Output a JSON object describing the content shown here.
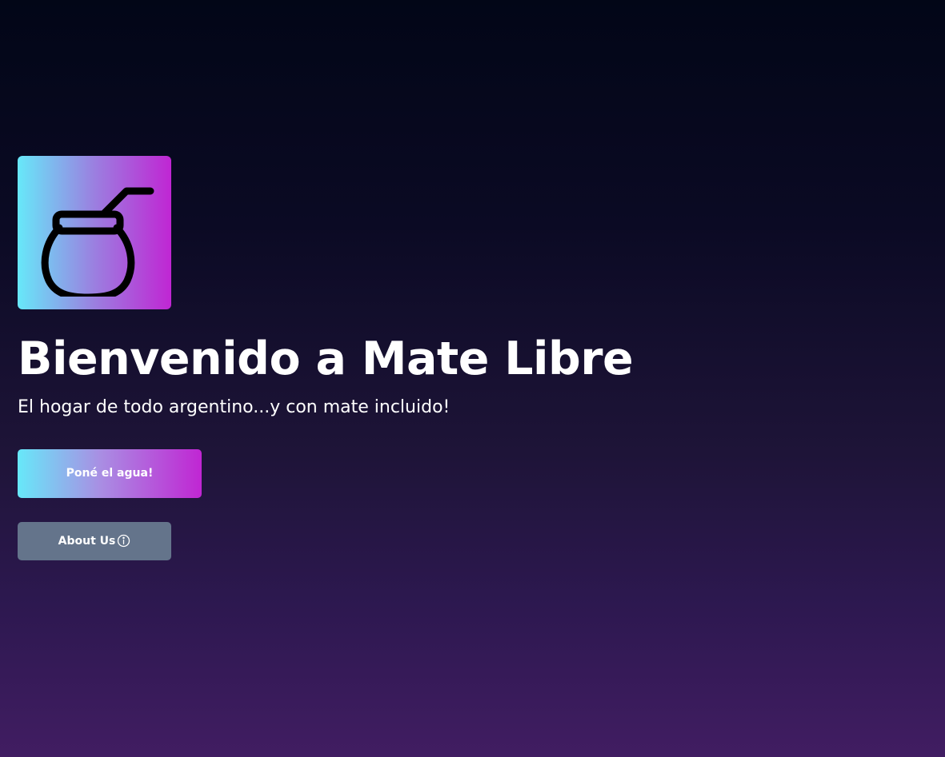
{
  "hero": {
    "logo_icon": "mate-gourd-icon",
    "title": "Bienvenido a Mate Libre",
    "subtitle": "El hogar de todo argentino...y con mate incluido!",
    "primary_button_label": "Poné el agua!",
    "secondary_button_label": "About Us",
    "secondary_button_icon": "info-circle-icon"
  },
  "colors": {
    "gradient_start": "#67e8f9",
    "gradient_end": "#c026d3",
    "secondary_button_bg": "#64748b",
    "background_top": "#020617",
    "background_bottom": "#411d62"
  }
}
